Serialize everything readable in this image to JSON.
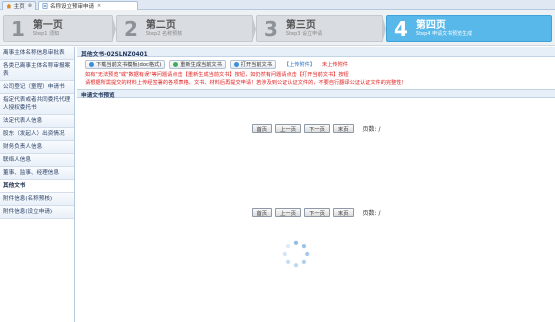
{
  "tabs": [
    {
      "label": "主页"
    },
    {
      "label": "名称设立预审申请"
    }
  ],
  "steps": [
    {
      "num": "1",
      "title": "第一页",
      "sub": "Step1 须知"
    },
    {
      "num": "2",
      "title": "第二页",
      "sub": "Step2 名称预核"
    },
    {
      "num": "3",
      "title": "第三页",
      "sub": "Step3 设立申请"
    },
    {
      "num": "4",
      "title": "第四页",
      "sub": "Step4 申请文书预览生成"
    }
  ],
  "sidebar": {
    "items": [
      {
        "label": "离事主体名称信息审批表"
      },
      {
        "label": "各类已离事主体名称审报案表"
      },
      {
        "label": "公司登记（童程）申请书"
      },
      {
        "label": "指定代表或者共同委托代理人授权委托书"
      },
      {
        "label": "法定代表人信息"
      },
      {
        "label": "股东（发起人）出资情况"
      },
      {
        "label": "财务负责人信息"
      },
      {
        "label": "联络人信息"
      },
      {
        "label": "董事、监事、经理信息"
      },
      {
        "label": "其他文书"
      },
      {
        "label": "附件信息(名称预核)"
      },
      {
        "label": "附件信息(设立申请)"
      }
    ]
  },
  "main": {
    "title": "其他文书-02SLNZ0401",
    "toolbar": {
      "download": "下载当前文书模板(doc格式)",
      "regenerate": "重新生成当前文书",
      "open": "打开当前文书",
      "upload_link": "【上传附件】",
      "not_uploaded": "未上传附件"
    },
    "notice_line1": "如有\"无法预览\"或\"数据有误\"等问题请点击【重新生成当前文书】按钮，如仍然有问题请点击【打开当前文书】按钮",
    "notice_line2": "请根据所需提交的材料上传经签署的各项表格、文书、材料后再提交申请！若涉及到公证认证文件的，不要自行翻译公证认证文件的完整性！",
    "preview_title": "申请文书预览",
    "pager": {
      "first": "首页",
      "prev": "上一页",
      "next": "下一页",
      "last": "末页",
      "page_label": "页数: /"
    }
  },
  "colors": {
    "active_step": "#58b8ea",
    "notice_red": "#e02020",
    "link_blue": "#1f6fc5"
  }
}
